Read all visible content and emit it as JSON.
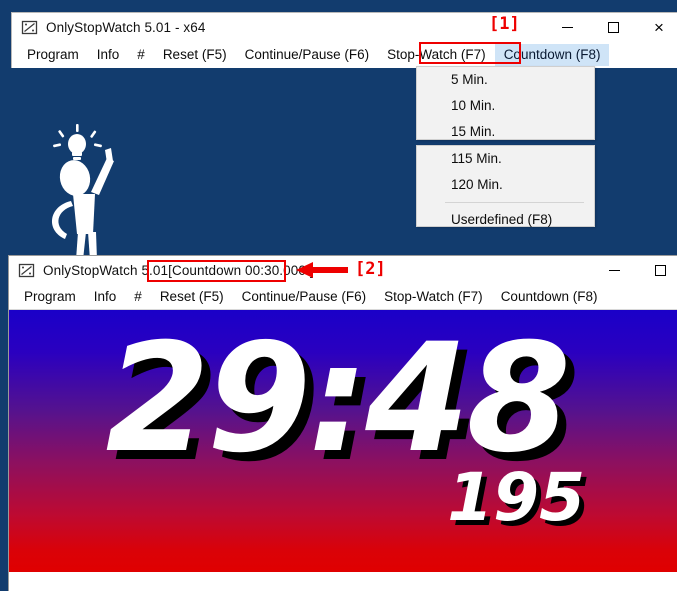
{
  "desktop": {
    "background_color": "#123c6e",
    "mascot": "stickman-idea-icon"
  },
  "window1": {
    "icon": "stopwatch-app-icon",
    "title": "OnlyStopWatch 5.01 - x64",
    "caption": {
      "minimize": "minimize-icon",
      "maximize": "maximize-icon",
      "close": "×"
    },
    "menu": [
      {
        "label": "Program",
        "highlighted": false
      },
      {
        "label": "Info",
        "highlighted": false
      },
      {
        "label": "#",
        "highlighted": false
      },
      {
        "label": "Reset  (F5)",
        "highlighted": false
      },
      {
        "label": "Continue/Pause (F6)",
        "highlighted": false
      },
      {
        "label": "Stop-Watch  (F7)",
        "highlighted": false
      },
      {
        "label": "Countdown  (F8)",
        "highlighted": true
      }
    ]
  },
  "countdown_menu": {
    "section_top": [
      {
        "label": "5 Min."
      },
      {
        "label": "10 Min."
      },
      {
        "label": "15 Min."
      }
    ],
    "section_bottom": [
      {
        "label": "115 Min."
      },
      {
        "label": "120 Min."
      }
    ],
    "footer": {
      "label": "Userdefined  (F8)"
    }
  },
  "window2": {
    "icon": "stopwatch-app-icon",
    "title_app": "OnlyStopWatch 5.01",
    "title_countdown": "[Countdown  00:30.000 ]",
    "caption": {
      "minimize": "minimize-icon",
      "maximize": "maximize-icon"
    },
    "menu": [
      {
        "label": "Program",
        "highlighted": false
      },
      {
        "label": "Info",
        "highlighted": false
      },
      {
        "label": "#",
        "highlighted": false
      },
      {
        "label": "Reset  (F5)",
        "highlighted": false
      },
      {
        "label": "Continue/Pause (F6)",
        "highlighted": false
      },
      {
        "label": "Stop-Watch  (F7)",
        "highlighted": false
      },
      {
        "label": "Countdown  (F8)",
        "highlighted": false
      }
    ],
    "display": {
      "time": "29:48",
      "milliseconds": "195",
      "gradient_top": "#1a00c8",
      "gradient_bottom": "#e00000"
    }
  },
  "annotations": {
    "marker1": "[1]",
    "marker2": "[2]",
    "color": "#ee0000",
    "arrow2": "left-arrow-icon"
  }
}
